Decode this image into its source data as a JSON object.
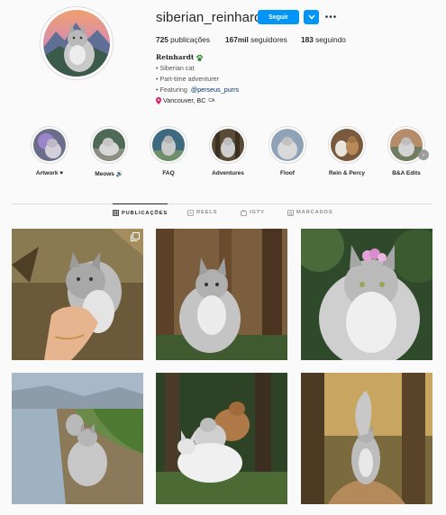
{
  "profile": {
    "username": "siberian_reinhardt",
    "follow_label": "Seguir",
    "avatar_alt": "profile-avatar"
  },
  "stats": {
    "posts_count": "725",
    "posts_label": "publicações",
    "followers_count": "167mil",
    "followers_label": "seguidores",
    "following_count": "183",
    "following_label": "seguindo"
  },
  "bio": {
    "name": "Reinhardt",
    "line1": "• Siberian cat",
    "line2": "• Part-time adventurer",
    "line3_prefix": "• Featuring ",
    "line3_link": "@perseus_purrs",
    "location": "Vancouver, BC",
    "country_code": "CA"
  },
  "highlights": [
    {
      "label": "Artwork ♥"
    },
    {
      "label": "Meows 🔊"
    },
    {
      "label": "FAQ"
    },
    {
      "label": "Adventures"
    },
    {
      "label": "Floof"
    },
    {
      "label": "Rein & Percy"
    },
    {
      "label": "B&A Edits"
    }
  ],
  "tabs": [
    {
      "label": "PUBLICAÇÕES",
      "icon": "grid-icon",
      "active": true
    },
    {
      "label": "REELS",
      "icon": "reels-icon",
      "active": false
    },
    {
      "label": "IGTV",
      "icon": "igtv-icon",
      "active": false
    },
    {
      "label": "MARCADOS",
      "icon": "tagged-icon",
      "active": false
    }
  ],
  "colors": {
    "accent": "#0095f6",
    "background": "#fafafa",
    "text": "#262626",
    "muted": "#8e8e8e",
    "link": "#00376b"
  }
}
